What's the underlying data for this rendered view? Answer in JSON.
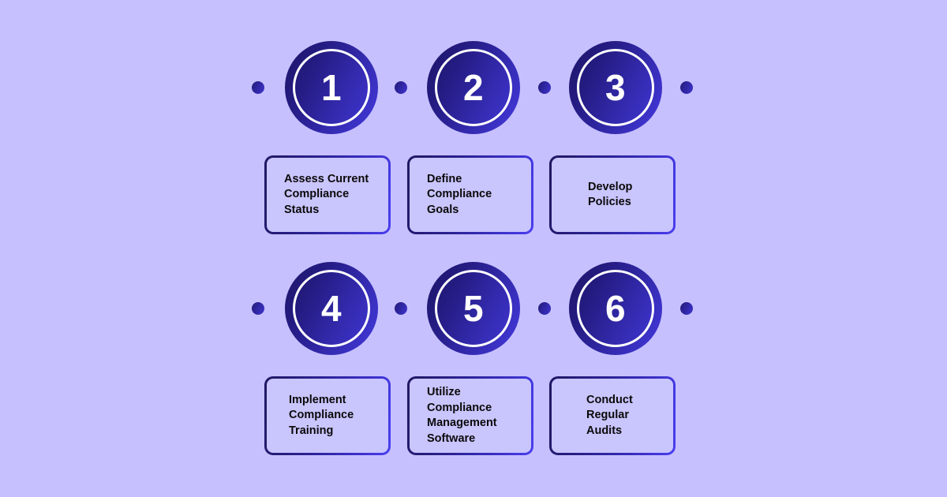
{
  "theme": {
    "background_color": "#C6C0FE",
    "circle_gradient_from": "#1D1566",
    "circle_gradient_to": "#4438DD",
    "circle_ring_color": "#FFFFFF",
    "box_fill_color": "#C9C5FD",
    "box_border_gradient_from": "#201862",
    "box_border_gradient_to": "#4A3EF0",
    "label_text_color": "#0A0A0A",
    "number_text_color": "#FFFFFF"
  },
  "diagram": {
    "type": "numbered-step-process",
    "total_steps": 6,
    "columns": 3,
    "rows": 2
  },
  "rows": [
    {
      "row_index": 1,
      "dots": [
        "dot",
        "dot",
        "dot",
        "dot"
      ],
      "steps": [
        {
          "number": "1",
          "label": "Assess Current\nCompliance\nStatus"
        },
        {
          "number": "2",
          "label": "Define\nCompliance\nGoals"
        },
        {
          "number": "3",
          "label": "Develop\nPolicies"
        }
      ]
    },
    {
      "row_index": 2,
      "dots": [
        "dot",
        "dot",
        "dot",
        "dot"
      ],
      "steps": [
        {
          "number": "4",
          "label": "Implement\nCompliance\nTraining"
        },
        {
          "number": "5",
          "label": "Utilize\nCompliance\nManagement\nSoftware"
        },
        {
          "number": "6",
          "label": "Conduct\nRegular\nAudits"
        }
      ]
    }
  ]
}
